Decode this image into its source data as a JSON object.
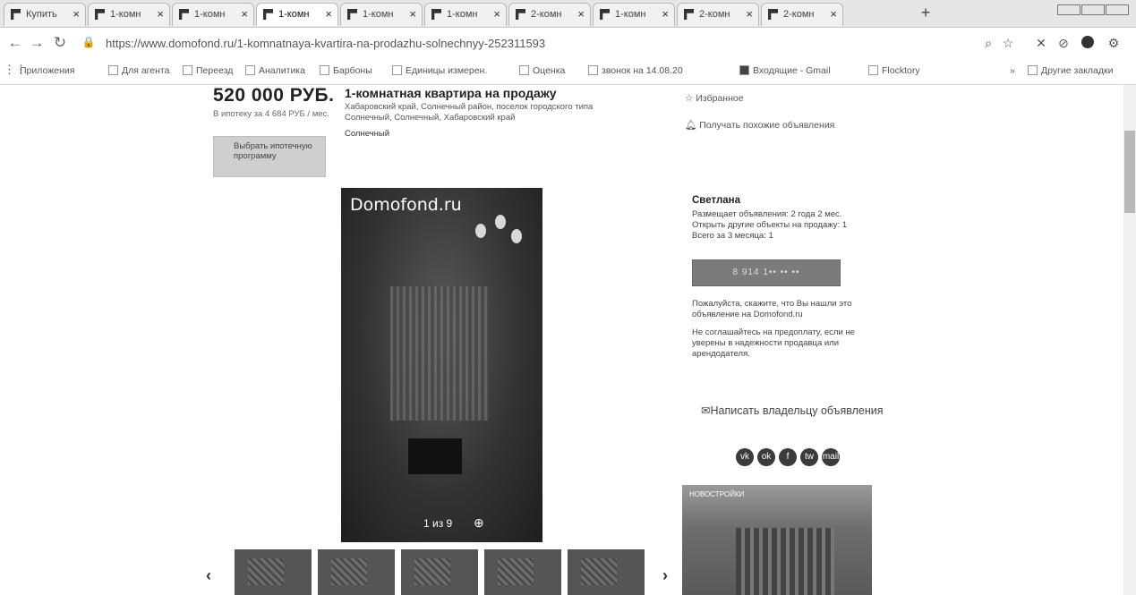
{
  "browser": {
    "tabs": [
      {
        "label": "Купить"
      },
      {
        "label": "1-комн"
      },
      {
        "label": "1-комн"
      },
      {
        "label": "1-комн"
      },
      {
        "label": "1-комн"
      },
      {
        "label": "1-комн"
      },
      {
        "label": "2-комн"
      },
      {
        "label": "1-комн"
      },
      {
        "label": "2-комн"
      },
      {
        "label": "2-комн"
      }
    ],
    "tab_close_glyph": "×",
    "new_tab_glyph": "+",
    "url": "https://www.domofond.ru/1-komnatnaya-kvartira-na-prodazhu-solnechnyy-252311593",
    "bookmarks": [
      "Приложения",
      "Для агента",
      "Переезд",
      "Аналитика",
      "Барбоны",
      "Единицы измерен.",
      "Оценка",
      "звонок на 14.08.20",
      "Входящие - Gmail",
      "Flocktory"
    ],
    "bookmarks_more": "»",
    "other_bookmarks": "Другие закладки"
  },
  "listing": {
    "price": "520 000 РУБ.",
    "mortgage_note": "В ипотеку за 4 684 РУБ / мес.",
    "mortgage_button": "Выбрать ипотечную программу",
    "title": "1-комнатная квартира на продажу",
    "address_line1": "Хабаровский край, Солнечный район, поселок городского типа",
    "address_line2": "Солнечный, Солнечный, Хабаровский край",
    "locality": "Солнечный",
    "favorite_label": "Избранное",
    "notify_label": "Получать похожие объявления"
  },
  "gallery": {
    "logo": "Domofond.ru",
    "counter": "1 из 9",
    "prev": "‹",
    "next": "›"
  },
  "seller": {
    "name": "Светлана",
    "line1": "Размещает объявления: 2 года 2 мес.",
    "line2": "Открыть другие объекты на продажу: 1",
    "line3": "Всего за 3 месяца: 1",
    "phone_button": "8 914 1•• •• ••",
    "tell_note": "Пожалуйста, скажите, что Вы нашли это объявление на Domofond.ru",
    "warn_note": "Не соглашайтесь на предоплату, если не уверены в надежности продавца или арендодателя.",
    "write_owner": "Написать владельцу объявления"
  },
  "social": [
    "vk",
    "ok",
    "f",
    "tw",
    "mail"
  ],
  "ad": {
    "caption": "НОВОСТРОЙКИ"
  }
}
